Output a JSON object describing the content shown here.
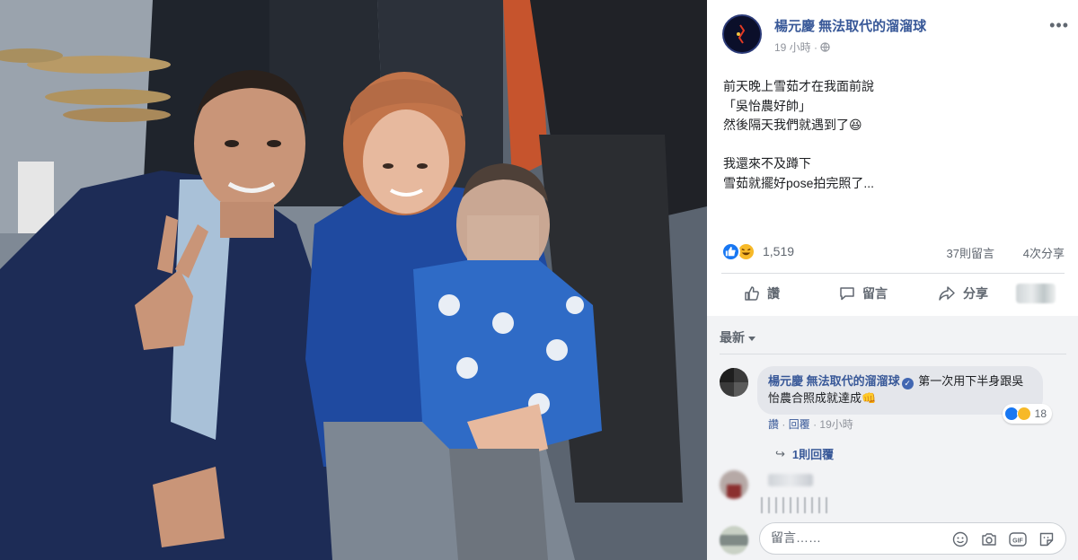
{
  "post": {
    "page_name": "楊元慶 無法取代的溜溜球",
    "time": "19 小時",
    "meta_separator": "·",
    "text_lines": [
      "前天晚上雪茹才在我面前說",
      "「吳怡農好帥」",
      "然後隔天我們就遇到了😆",
      "",
      "我還來不及蹲下",
      "雪茹就擺好pose拍完照了..."
    ]
  },
  "stats": {
    "reaction_count": "1,519",
    "comments": "37則留言",
    "shares": "4次分享"
  },
  "actions": {
    "like": "讚",
    "comment": "留言",
    "share": "分享"
  },
  "comments": {
    "sort_label": "最新",
    "first": {
      "author": "楊元慶 無法取代的溜溜球",
      "text": "第一次用下半身跟吳怡農合照成就達成👊",
      "reaction_count": "18",
      "like_label": "讚",
      "reply_label": "回覆",
      "time": "19小時",
      "separator": "·",
      "replies_label": "1則回覆"
    },
    "input_placeholder": "留言……"
  },
  "colors": {
    "link_blue": "#385898",
    "like_blue": "#1877f2",
    "haha_yellow": "#f7b928",
    "divider": "#dadde1",
    "comment_bg": "#f2f3f5"
  }
}
